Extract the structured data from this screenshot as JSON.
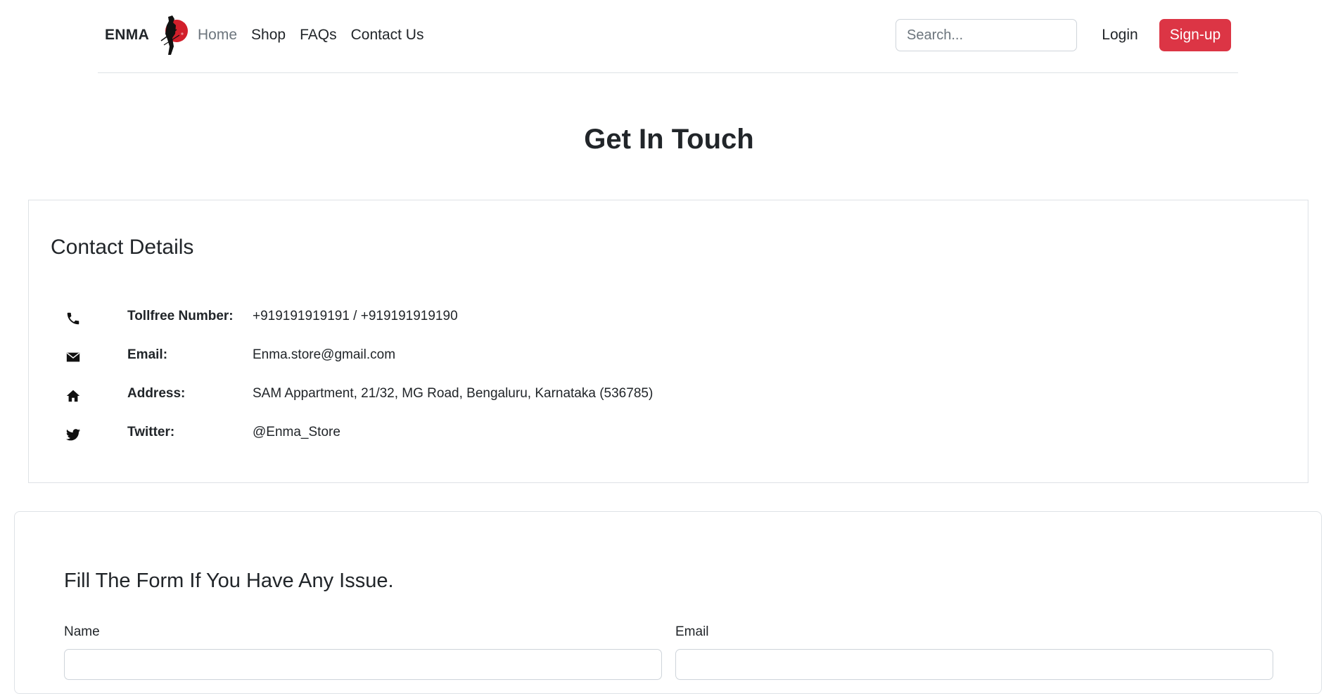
{
  "navbar": {
    "brand": "ENMA",
    "links": [
      {
        "label": "Home",
        "active": true
      },
      {
        "label": "Shop"
      },
      {
        "label": "FAQs"
      },
      {
        "label": "Contact Us"
      }
    ],
    "search_placeholder": "Search...",
    "login_label": "Login",
    "signup_label": "Sign-up"
  },
  "page": {
    "title": "Get In Touch"
  },
  "contact": {
    "title": "Contact Details",
    "items": [
      {
        "icon": "phone-icon",
        "label": "Tollfree Number:",
        "value": "+919191919191 / +919191919190"
      },
      {
        "icon": "envelope-icon",
        "label": "Email:",
        "value": "Enma.store@gmail.com"
      },
      {
        "icon": "home-icon",
        "label": "Address:",
        "value": "SAM Appartment, 21/32, MG Road, Bengaluru, Karnataka (536785)"
      },
      {
        "icon": "twitter-icon",
        "label": "Twitter:",
        "value": "@Enma_Store"
      }
    ]
  },
  "form": {
    "title": "Fill The Form If You Have Any Issue.",
    "name_label": "Name",
    "email_label": "Email",
    "name_value": "",
    "email_value": ""
  },
  "colors": {
    "accent": "#dc3545",
    "text": "#212529",
    "muted": "#6c757d",
    "border": "#dee2e6"
  }
}
